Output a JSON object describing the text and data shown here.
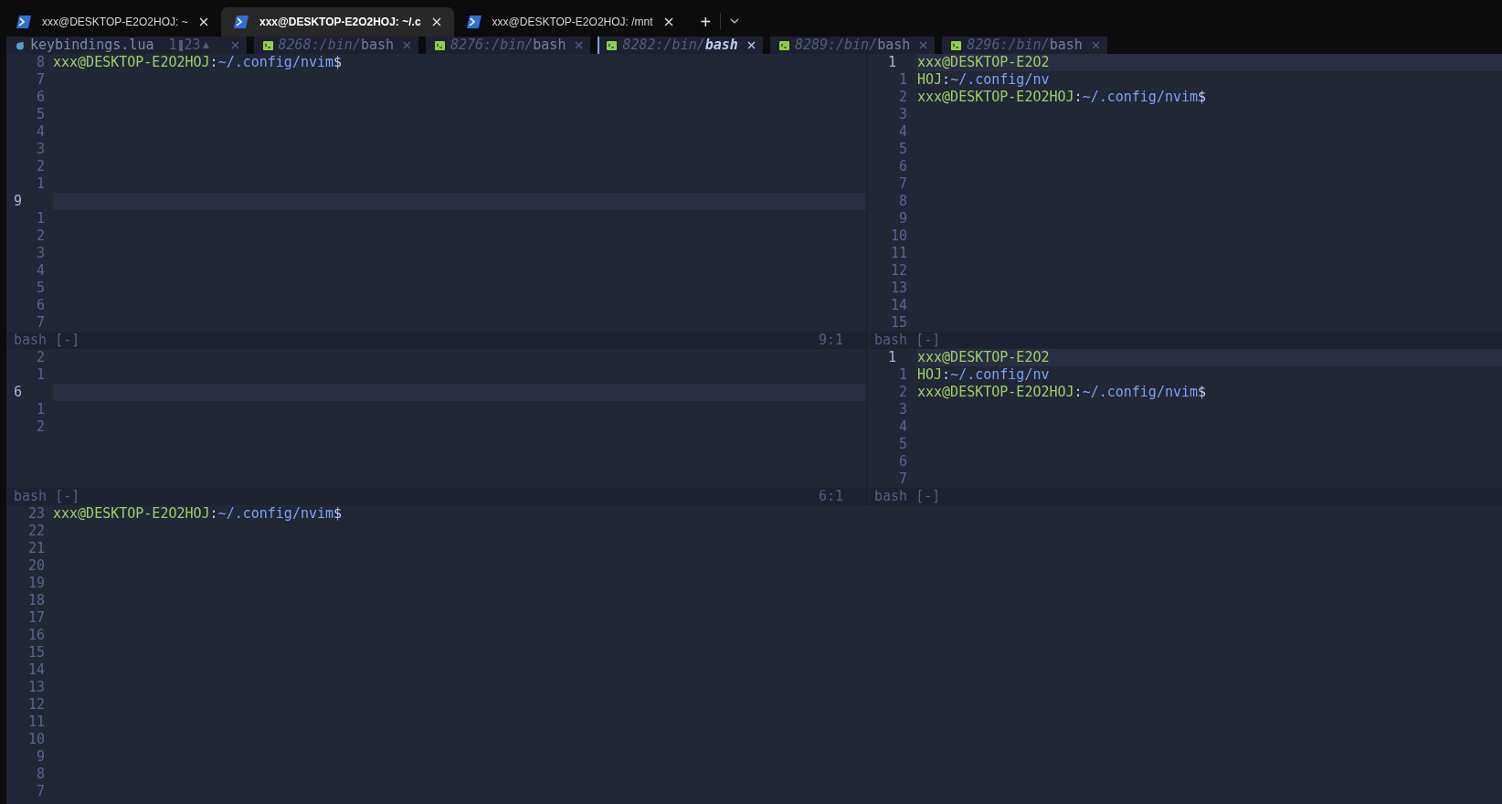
{
  "window_tabs": [
    {
      "title": "xxx@DESKTOP-E2O2HOJ: ~",
      "selected": false
    },
    {
      "title": "xxx@DESKTOP-E2O2HOJ: ~/.c",
      "selected": true
    },
    {
      "title": "xxx@DESKTOP-E2O2HOJ: /mnt",
      "selected": false
    }
  ],
  "new_tab": "+",
  "buffer_tabs": [
    {
      "kind": "file",
      "name": "keybindings.lua",
      "errors": "1",
      "warnings": "23",
      "selected": false
    },
    {
      "kind": "terminal",
      "path": "8268:/bin/",
      "name": "bash",
      "selected": false
    },
    {
      "kind": "terminal",
      "path": "8276:/bin/",
      "name": "bash",
      "selected": false
    },
    {
      "kind": "terminal",
      "path": "8282:/bin/",
      "name": "bash",
      "selected": true
    },
    {
      "kind": "terminal",
      "path": "8289:/bin/",
      "name": "bash",
      "selected": false
    },
    {
      "kind": "terminal",
      "path": "8296:/bin/",
      "name": "bash",
      "selected": false
    }
  ],
  "panes": [
    {
      "lines": [
        {
          "num": "8",
          "current": false,
          "segments": [
            {
              "kind": "user",
              "text": "xxx@DESKTOP-E2O2HOJ"
            },
            {
              "kind": "sym",
              "text": ":"
            },
            {
              "kind": "path",
              "text": "~/.config/nvim"
            },
            {
              "kind": "sym",
              "text": "$"
            }
          ]
        },
        {
          "num": "7",
          "current": false
        },
        {
          "num": "6",
          "current": false
        },
        {
          "num": "5",
          "current": false
        },
        {
          "num": "4",
          "current": false
        },
        {
          "num": "3",
          "current": false
        },
        {
          "num": "2",
          "current": false
        },
        {
          "num": "1",
          "current": false
        },
        {
          "num": "9",
          "current": true
        },
        {
          "num": "1",
          "current": false
        },
        {
          "num": "2",
          "current": false
        },
        {
          "num": "3",
          "current": false
        },
        {
          "num": "4",
          "current": false
        },
        {
          "num": "5",
          "current": false
        },
        {
          "num": "6",
          "current": false
        },
        {
          "num": "7",
          "current": false
        }
      ],
      "status": {
        "name": "bash",
        "flag": "[-]",
        "position": "9:1"
      }
    },
    {
      "lines": [
        {
          "num": "1",
          "current": true,
          "segments": [
            {
              "kind": "user",
              "text": "xxx@DESKTOP-E2O2"
            }
          ]
        },
        {
          "num": "1",
          "current": false,
          "segments": [
            {
              "kind": "user",
              "text": "HOJ"
            },
            {
              "kind": "sym",
              "text": ":"
            },
            {
              "kind": "path",
              "text": "~/.config/nv"
            }
          ]
        },
        {
          "num": "2",
          "current": false,
          "segments": [
            {
              "kind": "user",
              "text": "xxx@DESKTOP-E2O2HOJ"
            },
            {
              "kind": "sym",
              "text": ":"
            },
            {
              "kind": "path",
              "text": "~/.config/nvim"
            },
            {
              "kind": "sym",
              "text": "$"
            }
          ]
        },
        {
          "num": "3",
          "current": false
        },
        {
          "num": "4",
          "current": false
        },
        {
          "num": "5",
          "current": false
        },
        {
          "num": "6",
          "current": false
        },
        {
          "num": "7",
          "current": false
        },
        {
          "num": "8",
          "current": false
        },
        {
          "num": "9",
          "current": false
        },
        {
          "num": "10",
          "current": false
        },
        {
          "num": "11",
          "current": false
        },
        {
          "num": "12",
          "current": false
        },
        {
          "num": "13",
          "current": false
        },
        {
          "num": "14",
          "current": false
        },
        {
          "num": "15",
          "current": false
        }
      ],
      "status": {
        "name": "bash",
        "flag": "[-]"
      }
    },
    {
      "lines": [
        {
          "num": "2",
          "current": false
        },
        {
          "num": "1",
          "current": false
        },
        {
          "num": "6",
          "current": true
        },
        {
          "num": "1",
          "current": false
        },
        {
          "num": "2",
          "current": false
        }
      ],
      "status": {
        "name": "bash",
        "flag": "[-]",
        "position": "6:1"
      }
    },
    {
      "lines": [
        {
          "num": "1",
          "current": true,
          "segments": [
            {
              "kind": "user",
              "text": "xxx@DESKTOP-E2O2"
            }
          ]
        },
        {
          "num": "1",
          "current": false,
          "segments": [
            {
              "kind": "user",
              "text": "HOJ"
            },
            {
              "kind": "sym",
              "text": ":"
            },
            {
              "kind": "path",
              "text": "~/.config/nv"
            }
          ]
        },
        {
          "num": "2",
          "current": false,
          "segments": [
            {
              "kind": "user",
              "text": "xxx@DESKTOP-E2O2HOJ"
            },
            {
              "kind": "sym",
              "text": ":"
            },
            {
              "kind": "path",
              "text": "~/.config/nvim"
            },
            {
              "kind": "sym",
              "text": "$"
            }
          ]
        },
        {
          "num": "3",
          "current": false
        },
        {
          "num": "4",
          "current": false
        },
        {
          "num": "5",
          "current": false
        },
        {
          "num": "6",
          "current": false
        },
        {
          "num": "7",
          "current": false
        }
      ],
      "status": {
        "name": "bash",
        "flag": "[-]"
      }
    },
    {
      "lines": [
        {
          "num": "23",
          "current": false,
          "segments": [
            {
              "kind": "user",
              "text": "xxx@DESKTOP-E2O2HOJ"
            },
            {
              "kind": "sym",
              "text": ":"
            },
            {
              "kind": "path",
              "text": "~/.config/nvim"
            },
            {
              "kind": "sym",
              "text": "$"
            }
          ]
        },
        {
          "num": "22",
          "current": false
        },
        {
          "num": "21",
          "current": false
        },
        {
          "num": "20",
          "current": false
        },
        {
          "num": "19",
          "current": false
        },
        {
          "num": "18",
          "current": false
        },
        {
          "num": "17",
          "current": false
        },
        {
          "num": "16",
          "current": false
        },
        {
          "num": "15",
          "current": false
        },
        {
          "num": "14",
          "current": false
        },
        {
          "num": "13",
          "current": false
        },
        {
          "num": "12",
          "current": false
        },
        {
          "num": "11",
          "current": false
        },
        {
          "num": "10",
          "current": false
        },
        {
          "num": "9",
          "current": false
        },
        {
          "num": "8",
          "current": false
        },
        {
          "num": "7",
          "current": false
        }
      ]
    }
  ]
}
